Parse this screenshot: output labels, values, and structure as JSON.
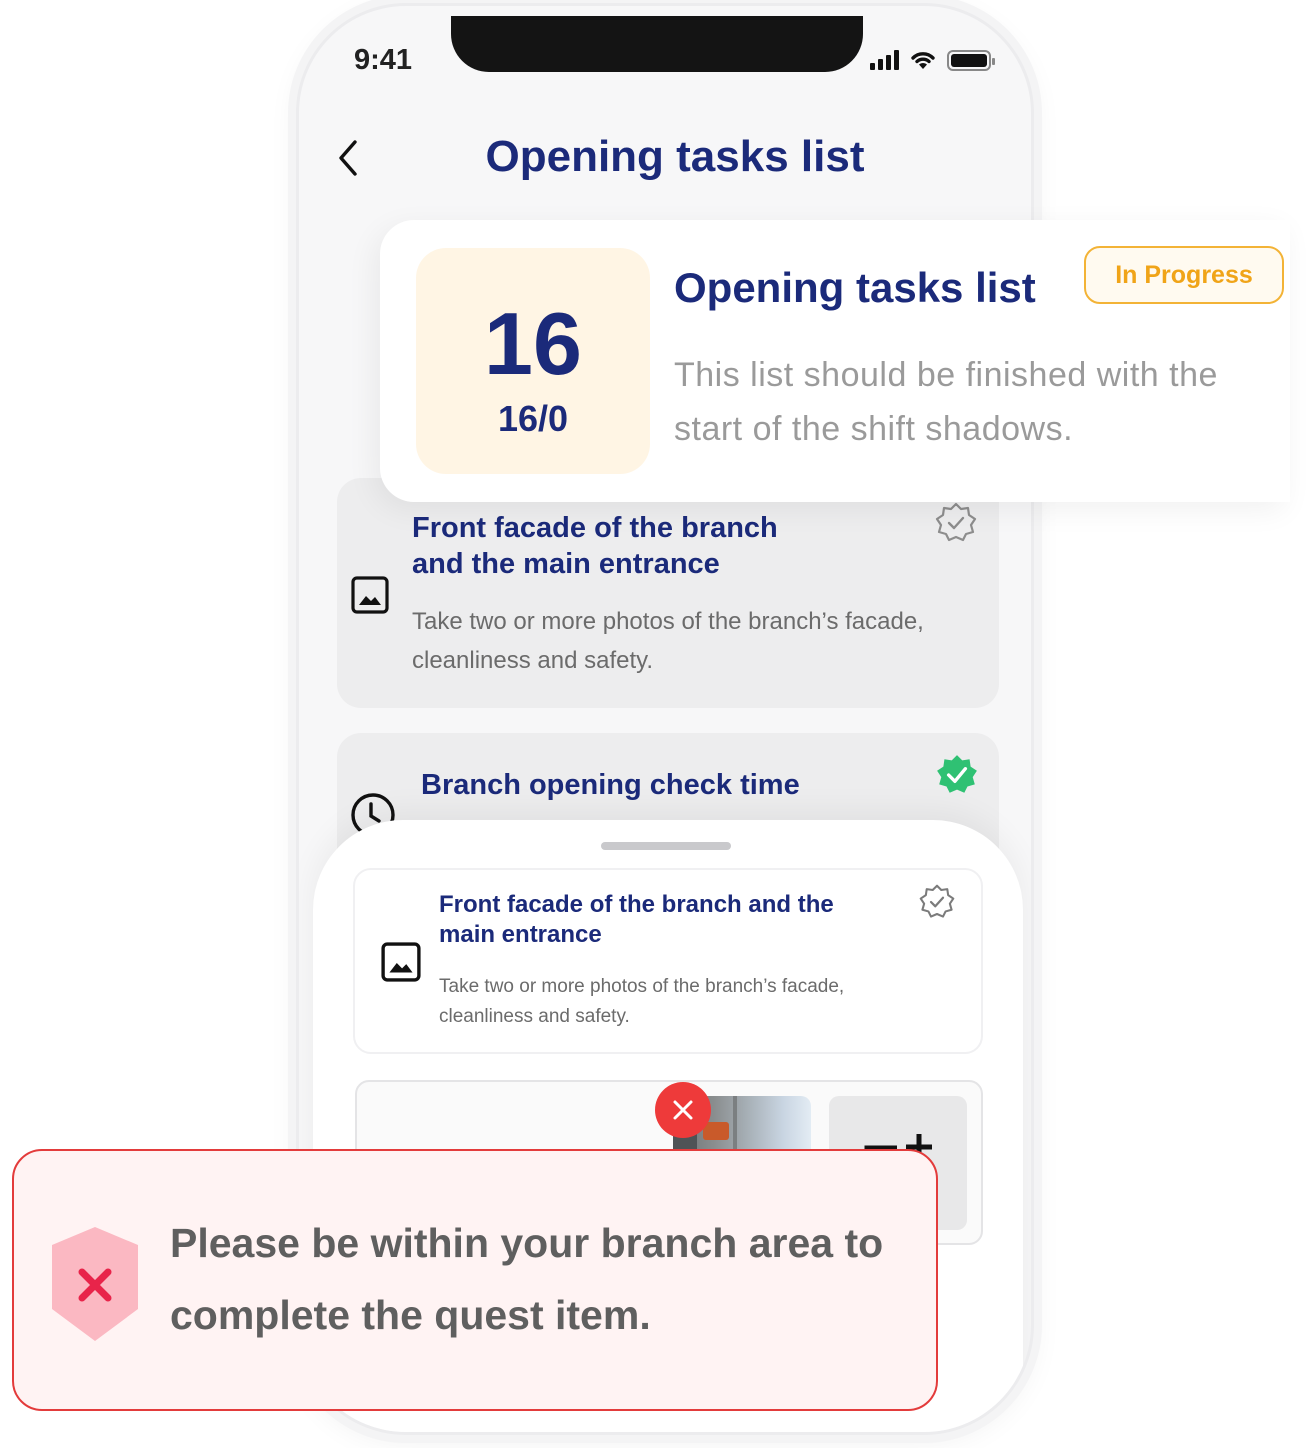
{
  "status_bar": {
    "time": "9:41"
  },
  "header": {
    "title": "Opening tasks list"
  },
  "summary": {
    "count": "16",
    "ratio": "16/0",
    "title": "Opening tasks list",
    "description": "This list should be finished with the start of the shift shadows.",
    "status": "In Progress"
  },
  "tasks": [
    {
      "title": "Front facade of the branch and the main entrance",
      "description": "Take two or more photos of the branch’s facade, cleanliness and safety.",
      "icon": "image-icon",
      "verified": false
    },
    {
      "title": "Branch opening check time",
      "icon": "clock-icon",
      "verified": true
    }
  ],
  "sheet": {
    "task": {
      "title": "Front facade of the branch and the main entrance",
      "description": "Take two or more photos of the branch’s facade, cleanliness and safety.",
      "icon": "image-icon"
    }
  },
  "toast": {
    "message": "Please be within your branch area to complete the quest item.",
    "icon": "error-shield-icon"
  },
  "colors": {
    "primary": "#1b2a7a",
    "badge": "#f0a418",
    "success": "#2fc173",
    "error": "#e33b3b"
  }
}
